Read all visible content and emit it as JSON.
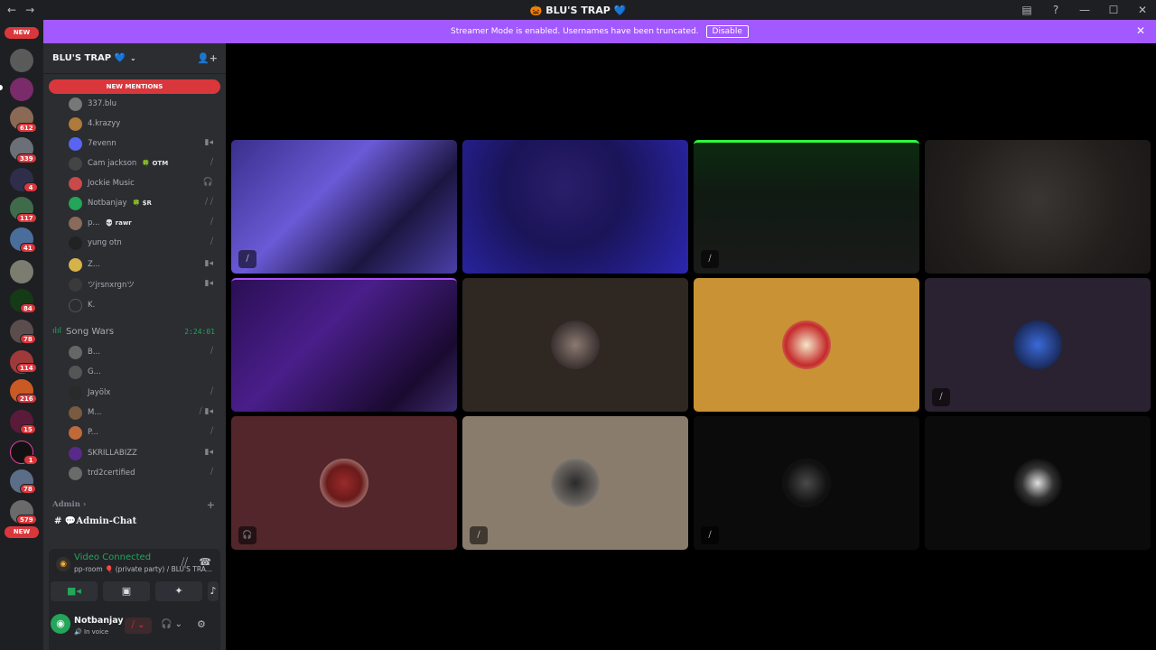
{
  "window": {
    "title": "🎃 BLU'S TRAP 💙",
    "back": "←",
    "forward": "→",
    "inbox_icon": "▤",
    "help_icon": "?",
    "min": "—",
    "max": "☐",
    "close": "✕"
  },
  "banner": {
    "text": "Streamer Mode is enabled. Usernames have been truncated.",
    "disable_label": "Disable",
    "close": "✕"
  },
  "rail": {
    "new_top": "NEW",
    "new_bottom": "NEW",
    "badges": [
      "612",
      "339",
      "4",
      "117",
      "41",
      "84",
      "78",
      "114",
      "216",
      "15",
      "1",
      "78",
      "579"
    ]
  },
  "server": {
    "name": "BLU'S TRAP 💙",
    "chevron": "⌄",
    "add_people_icon": "👤+",
    "new_mentions": "NEW MENTIONS"
  },
  "voice_users_top": [
    {
      "name": "337.blu",
      "tag": "",
      "status": ""
    },
    {
      "name": "4.krazyy",
      "tag": "",
      "status": ""
    },
    {
      "name": "7evenn",
      "tag": "",
      "status": "▮◂"
    },
    {
      "name": "Cam jackson",
      "tag": "🍀 OTM",
      "status": "⧸"
    },
    {
      "name": "Jockie Music",
      "tag": "",
      "status": "🎧"
    },
    {
      "name": "Notbanjay",
      "tag": "🍀 $R",
      "status": "⧸ ⧸"
    },
    {
      "name": "p...",
      "tag": "💀 rawr",
      "status": "⧸"
    },
    {
      "name": "yung otn",
      "tag": "",
      "status": "⧸"
    },
    {
      "name": "Z...",
      "tag": "",
      "status": "▮◂"
    },
    {
      "name": "ツjrsnxrgnツ",
      "tag": "",
      "status": "▮◂"
    },
    {
      "name": "K.",
      "tag": "",
      "status": ""
    }
  ],
  "song_wars": {
    "bars": "ılıl",
    "name": "Song Wars",
    "timer": "2:24:01"
  },
  "voice_users_song": [
    {
      "name": "B...",
      "status": "⧸"
    },
    {
      "name": "G...",
      "status": ""
    },
    {
      "name": "Jayölx",
      "status": "⧸"
    },
    {
      "name": "M...",
      "status": "⧸ ▮◂"
    },
    {
      "name": "P...",
      "status": "⧸"
    },
    {
      "name": "SKRILLABIZZ",
      "status": "▮◂"
    },
    {
      "name": "trd2certified",
      "status": "⧸"
    }
  ],
  "admin": {
    "category": "Admin ›",
    "plus": "+",
    "channel": "# 💬Admin-Chat"
  },
  "voice_panel": {
    "title": "Video Connected",
    "subtitle": "pp-room 🎈 (private party) / BLU'S TRA...",
    "signal_icon": "◉",
    "noise_icon": "⧸⧸",
    "leave_icon": "☎",
    "btn_camera": "■◂",
    "btn_screen": "▣",
    "btn_activity": "✦",
    "btn_soundboard": "♪"
  },
  "user": {
    "name": "Notbanjay",
    "status": "🔊 In voice",
    "avatar_glyph": "◉",
    "mic_icon": "⧸ ⌄",
    "headset_icon": "🎧 ⌄",
    "gear_icon": "⚙"
  },
  "tiles": [
    {
      "label": "video-stream-1",
      "indicator": "⧸"
    },
    {
      "label": "video-stream-2",
      "indicator": ""
    },
    {
      "label": "video-stream-3",
      "indicator": "⧸"
    },
    {
      "label": "video-stream-4",
      "indicator": ""
    },
    {
      "label": "video-stream-5",
      "indicator": ""
    },
    {
      "label": "avatar-tile-6",
      "indicator": ""
    },
    {
      "label": "avatar-tile-7",
      "indicator": ""
    },
    {
      "label": "avatar-tile-8",
      "indicator": "⧸"
    },
    {
      "label": "avatar-tile-9",
      "indicator": "🎧"
    },
    {
      "label": "avatar-tile-10",
      "indicator": "⧸"
    },
    {
      "label": "avatar-tile-11",
      "indicator": "⧸"
    },
    {
      "label": "avatar-tile-12",
      "indicator": ""
    }
  ],
  "colors": {
    "accent_purple": "#a259ff",
    "danger": "#da373c",
    "online_green": "#23a55a",
    "tile_dark_brown": "#2f2722",
    "tile_gold": "#c99234",
    "tile_dark_purple": "#2a2230",
    "tile_maroon": "#52262b",
    "tile_taupe": "#8a7c6c",
    "tile_black": "#0b0b0b"
  }
}
